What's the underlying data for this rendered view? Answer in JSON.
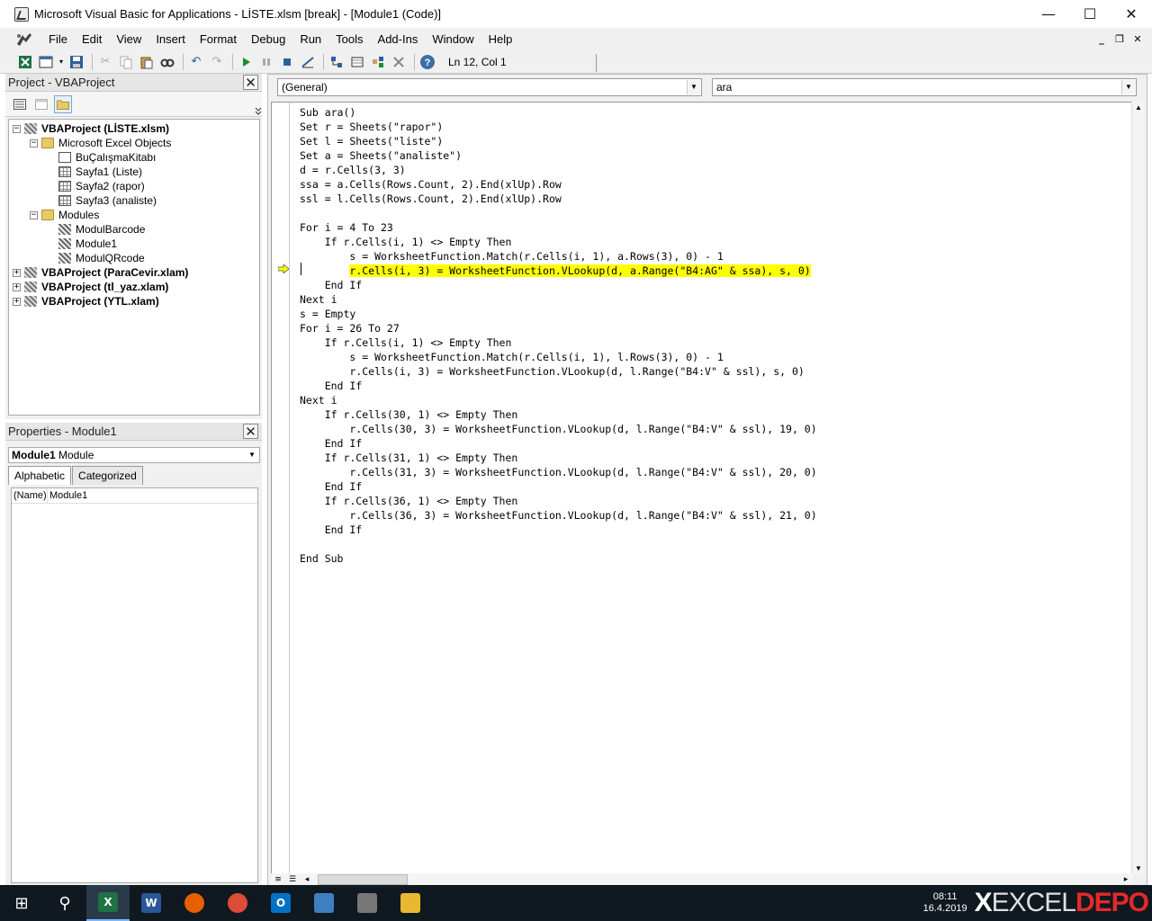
{
  "window": {
    "title": "Microsoft Visual Basic for Applications - LİSTE.xlsm [break] - [Module1 (Code)]",
    "minimize": "—",
    "maximize": "☐",
    "close": "✕"
  },
  "menu": {
    "items": [
      "File",
      "Edit",
      "View",
      "Insert",
      "Format",
      "Debug",
      "Run",
      "Tools",
      "Add-Ins",
      "Window",
      "Help"
    ],
    "mdi_min": "_",
    "mdi_restore": "❐",
    "mdi_close": "✕"
  },
  "toolbar": {
    "position": "Ln 12, Col 1"
  },
  "project": {
    "title": "Project - VBAProject",
    "close": "✕",
    "tree": [
      {
        "label": "VBAProject (LİSTE.xlsm)",
        "level": 0,
        "expander": "−",
        "icon": "project-icon",
        "bold": true
      },
      {
        "label": "Microsoft Excel Objects",
        "level": 1,
        "expander": "−",
        "icon": "folder-icon",
        "bold": false
      },
      {
        "label": "BuÇalışmaKitabı",
        "level": 2,
        "expander": "",
        "icon": "workbook-icon",
        "bold": false
      },
      {
        "label": "Sayfa1 (Liste)",
        "level": 2,
        "expander": "",
        "icon": "sheet-icon",
        "bold": false
      },
      {
        "label": "Sayfa2 (rapor)",
        "level": 2,
        "expander": "",
        "icon": "sheet-icon",
        "bold": false
      },
      {
        "label": "Sayfa3 (analiste)",
        "level": 2,
        "expander": "",
        "icon": "sheet-icon",
        "bold": false
      },
      {
        "label": "Modules",
        "level": 1,
        "expander": "−",
        "icon": "folder-icon",
        "bold": false
      },
      {
        "label": "ModulBarcode",
        "level": 2,
        "expander": "",
        "icon": "module-icon",
        "bold": false
      },
      {
        "label": "Module1",
        "level": 2,
        "expander": "",
        "icon": "module-icon",
        "bold": false
      },
      {
        "label": "ModulQRcode",
        "level": 2,
        "expander": "",
        "icon": "module-icon",
        "bold": false
      },
      {
        "label": "VBAProject (ParaCevir.xlam)",
        "level": 0,
        "expander": "+",
        "icon": "project-icon",
        "bold": true
      },
      {
        "label": "VBAProject (tl_yaz.xlam)",
        "level": 0,
        "expander": "+",
        "icon": "project-icon",
        "bold": true
      },
      {
        "label": "VBAProject (YTL.xlam)",
        "level": 0,
        "expander": "+",
        "icon": "project-icon",
        "bold": true
      }
    ]
  },
  "properties": {
    "title": "Properties - Module1",
    "close": "✕",
    "object_name": "Module1",
    "object_type": "Module",
    "tabs": [
      "Alphabetic",
      "Categorized"
    ],
    "rows": [
      {
        "key": "(Name)",
        "value": "Module1"
      }
    ]
  },
  "code": {
    "object_combo": "(General)",
    "proc_combo": "ara",
    "highlight_line": 11,
    "lines": [
      "Sub ara()",
      "Set r = Sheets(\"rapor\")",
      "Set l = Sheets(\"liste\")",
      "Set a = Sheets(\"analiste\")",
      "d = r.Cells(3, 3)",
      "ssa = a.Cells(Rows.Count, 2).End(xlUp).Row",
      "ssl = l.Cells(Rows.Count, 2).End(xlUp).Row",
      "",
      "For i = 4 To 23",
      "    If r.Cells(i, 1) <> Empty Then",
      "        s = WorksheetFunction.Match(r.Cells(i, 1), a.Rows(3), 0) - 1",
      "        r.Cells(i, 3) = WorksheetFunction.VLookup(d, a.Range(\"B4:AG\" & ssa), s, 0)",
      "    End If",
      "Next i",
      "s = Empty",
      "For i = 26 To 27",
      "    If r.Cells(i, 1) <> Empty Then",
      "        s = WorksheetFunction.Match(r.Cells(i, 1), l.Rows(3), 0) - 1",
      "        r.Cells(i, 3) = WorksheetFunction.VLookup(d, l.Range(\"B4:V\" & ssl), s, 0)",
      "    End If",
      "Next i",
      "    If r.Cells(30, 1) <> Empty Then",
      "        r.Cells(30, 3) = WorksheetFunction.VLookup(d, l.Range(\"B4:V\" & ssl), 19, 0)",
      "    End If",
      "    If r.Cells(31, 1) <> Empty Then",
      "        r.Cells(31, 3) = WorksheetFunction.VLookup(d, l.Range(\"B4:V\" & ssl), 20, 0)",
      "    End If",
      "    If r.Cells(36, 1) <> Empty Then",
      "        r.Cells(36, 3) = WorksheetFunction.VLookup(d, l.Range(\"B4:V\" & ssl), 21, 0)",
      "    End If",
      "",
      "End Sub"
    ]
  },
  "taskbar": {
    "items": [
      {
        "name": "start-icon",
        "label": "⊞",
        "color": "#ffffff"
      },
      {
        "name": "search-icon",
        "label": "⚲",
        "color": "#ffffff"
      },
      {
        "name": "excel-icon",
        "label": "X",
        "color": "#1f7244"
      },
      {
        "name": "word-icon",
        "label": "W",
        "color": "#2b579a"
      },
      {
        "name": "firefox-icon",
        "label": "",
        "color": "#e66000"
      },
      {
        "name": "chrome-icon",
        "label": "",
        "color": "#dd4b39"
      },
      {
        "name": "outlook-icon",
        "label": "O",
        "color": "#0072c6"
      },
      {
        "name": "app-icon",
        "label": "",
        "color": "#3d7fc1"
      },
      {
        "name": "vba-icon",
        "label": "",
        "color": "#777777"
      },
      {
        "name": "explorer-icon",
        "label": "",
        "color": "#e8b930"
      }
    ],
    "clock_time": "08:11",
    "clock_date": "16.4.2019",
    "brand_x": "X",
    "brand_excel": "EXCEL",
    "brand_depo": "DEPO"
  }
}
